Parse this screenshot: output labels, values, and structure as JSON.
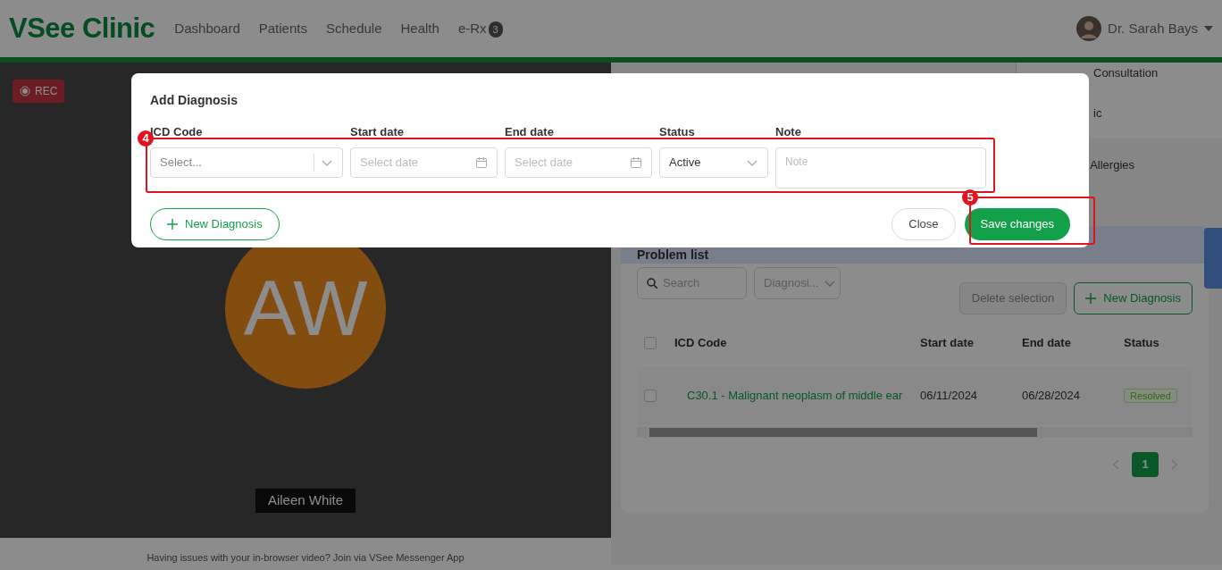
{
  "navbar": {
    "brand": "VSee Clinic",
    "links": [
      {
        "label": "Dashboard"
      },
      {
        "label": "Patients"
      },
      {
        "label": "Schedule"
      },
      {
        "label": "Health"
      },
      {
        "label": "e-Rx",
        "badge": "3"
      }
    ],
    "user": "Dr. Sarah Bays"
  },
  "video": {
    "rec_label": "REC",
    "initials": "AW",
    "participant": "Aileen White",
    "help_text": "Having issues with your in-browser video? Join via VSee Messenger App"
  },
  "side_items": [
    {
      "label": "Consultation"
    },
    {
      "label": "ic"
    }
  ],
  "tabs": [
    {
      "label": "Allergies"
    }
  ],
  "problem_list": {
    "title": "Problem list",
    "select_all_checked": false,
    "search_placeholder": "Search",
    "filter": "Diagnosi...",
    "delete_button": {
      "label": "Delete selection",
      "disabled": true
    },
    "new_button": "New Diagnosis",
    "columns": [
      "ICD Code",
      "Start date",
      "End date",
      "Status"
    ],
    "rows": [
      {
        "icd": "C30.1 - Malignant neoplasm of middle ear",
        "start": "06/11/2024",
        "end": "06/28/2024",
        "status": "Resolved",
        "checked": false
      }
    ],
    "pages": [
      {
        "label": "1",
        "selected": true
      }
    ]
  },
  "modal": {
    "title": "Add Diagnosis",
    "fields": [
      {
        "label": "ICD Code",
        "kind": "select",
        "placeholder": "Select..."
      },
      {
        "label": "Start date",
        "kind": "date",
        "placeholder": "Select date"
      },
      {
        "label": "End date",
        "kind": "date",
        "placeholder": "Select date"
      },
      {
        "label": "Status",
        "kind": "dropdown",
        "value": "Active"
      },
      {
        "label": "Note",
        "kind": "textarea",
        "placeholder": "Note"
      }
    ],
    "new_button": "New Diagnosis",
    "close_button": "Close",
    "save_button": "Save changes"
  },
  "annotations": [
    {
      "number": "4"
    },
    {
      "number": "5"
    }
  ]
}
